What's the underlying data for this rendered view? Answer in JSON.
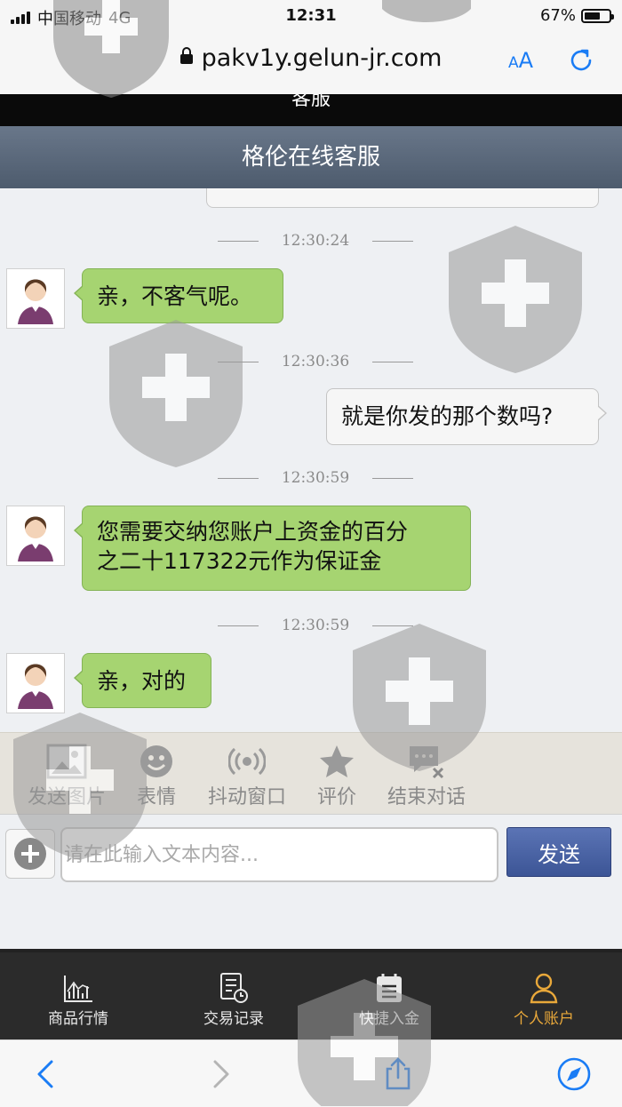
{
  "status_bar": {
    "carrier": "中国移动",
    "network": "4G",
    "time": "12:31",
    "battery": "67%",
    "battery_level": 0.67
  },
  "browser": {
    "url": "pakv1y.gelun-jr.com",
    "text_size_label": "AA"
  },
  "page": {
    "site_title": "客服",
    "chat_title": "格伦在线客服"
  },
  "messages": [
    {
      "time": "12:30:24",
      "sender": "agent",
      "text": "亲，不客气呢。"
    },
    {
      "time": "12:30:36",
      "sender": "user",
      "text": "就是你发的那个数吗?"
    },
    {
      "time": "12:30:59",
      "sender": "agent",
      "line1": "您需要交纳您账户上资金的百分",
      "line2": "之二十117322元作为保证金"
    },
    {
      "time": "12:30:59",
      "sender": "agent",
      "text": "亲，对的"
    }
  ],
  "toolbar": {
    "items": [
      {
        "label": "发送图片",
        "icon": "image-icon"
      },
      {
        "label": "表情",
        "icon": "smiley-icon"
      },
      {
        "label": "抖动窗口",
        "icon": "vibrate-icon"
      },
      {
        "label": "评价",
        "icon": "star-icon"
      },
      {
        "label": "结束对话",
        "icon": "end-chat-icon"
      }
    ]
  },
  "composer": {
    "placeholder": "请在此输入文本内容...",
    "send_label": "发送"
  },
  "bottom_nav": {
    "items": [
      {
        "label": "商品行情",
        "icon": "chart-icon"
      },
      {
        "label": "交易记录",
        "icon": "records-icon"
      },
      {
        "label": "快捷入金",
        "icon": "deposit-icon"
      },
      {
        "label": "个人账户",
        "icon": "user-icon",
        "active": true
      }
    ]
  },
  "colors": {
    "accent_link": "#1a7cf5",
    "agent_bubble": "#a6d471",
    "send_button": "#3c5596",
    "nav_active": "#e9a83a",
    "header": "#5b6a7d"
  }
}
